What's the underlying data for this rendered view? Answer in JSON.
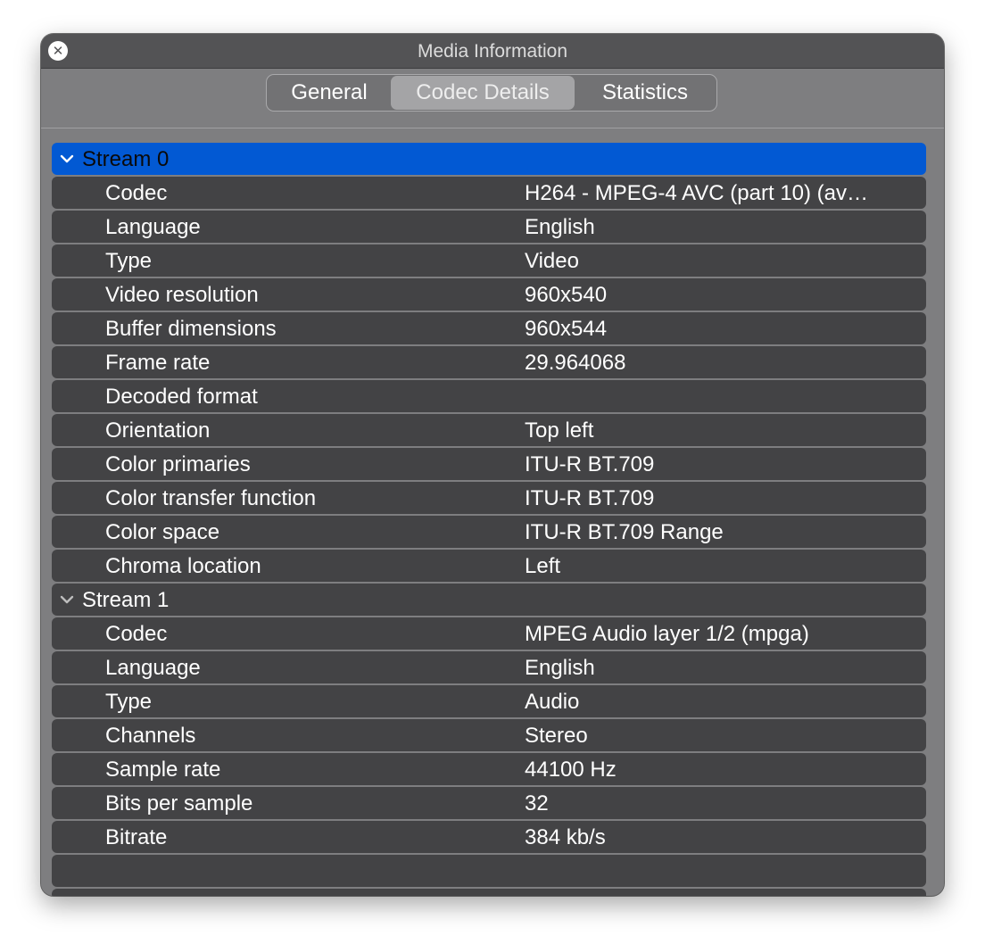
{
  "window": {
    "title": "Media Information",
    "close_icon": "close-circle-icon"
  },
  "tabs": [
    {
      "label": "General",
      "selected": false
    },
    {
      "label": "Codec Details",
      "selected": true
    },
    {
      "label": "Statistics",
      "selected": false
    }
  ],
  "streams": [
    {
      "label": "Stream 0",
      "expanded": true,
      "selected": true,
      "properties": [
        {
          "key": "Codec",
          "value": "H264 - MPEG-4 AVC (part 10) (av…"
        },
        {
          "key": "Language",
          "value": "English"
        },
        {
          "key": "Type",
          "value": "Video"
        },
        {
          "key": "Video resolution",
          "value": "960x540"
        },
        {
          "key": "Buffer dimensions",
          "value": "960x544"
        },
        {
          "key": "Frame rate",
          "value": "29.964068"
        },
        {
          "key": "Decoded format",
          "value": ""
        },
        {
          "key": "Orientation",
          "value": "Top left"
        },
        {
          "key": "Color primaries",
          "value": "ITU-R BT.709"
        },
        {
          "key": "Color transfer function",
          "value": "ITU-R BT.709"
        },
        {
          "key": "Color space",
          "value": "ITU-R BT.709 Range"
        },
        {
          "key": "Chroma location",
          "value": "Left"
        }
      ]
    },
    {
      "label": "Stream 1",
      "expanded": true,
      "selected": false,
      "properties": [
        {
          "key": "Codec",
          "value": "MPEG Audio layer 1/2 (mpga)"
        },
        {
          "key": "Language",
          "value": "English"
        },
        {
          "key": "Type",
          "value": "Audio"
        },
        {
          "key": "Channels",
          "value": "Stereo"
        },
        {
          "key": "Sample rate",
          "value": "44100 Hz"
        },
        {
          "key": "Bits per sample",
          "value": "32"
        },
        {
          "key": "Bitrate",
          "value": "384 kb/s"
        }
      ]
    }
  ],
  "colors": {
    "selection": "#0259d3",
    "row_background": "#434345",
    "window_background": "#7e7e80",
    "titlebar": "#535355"
  }
}
